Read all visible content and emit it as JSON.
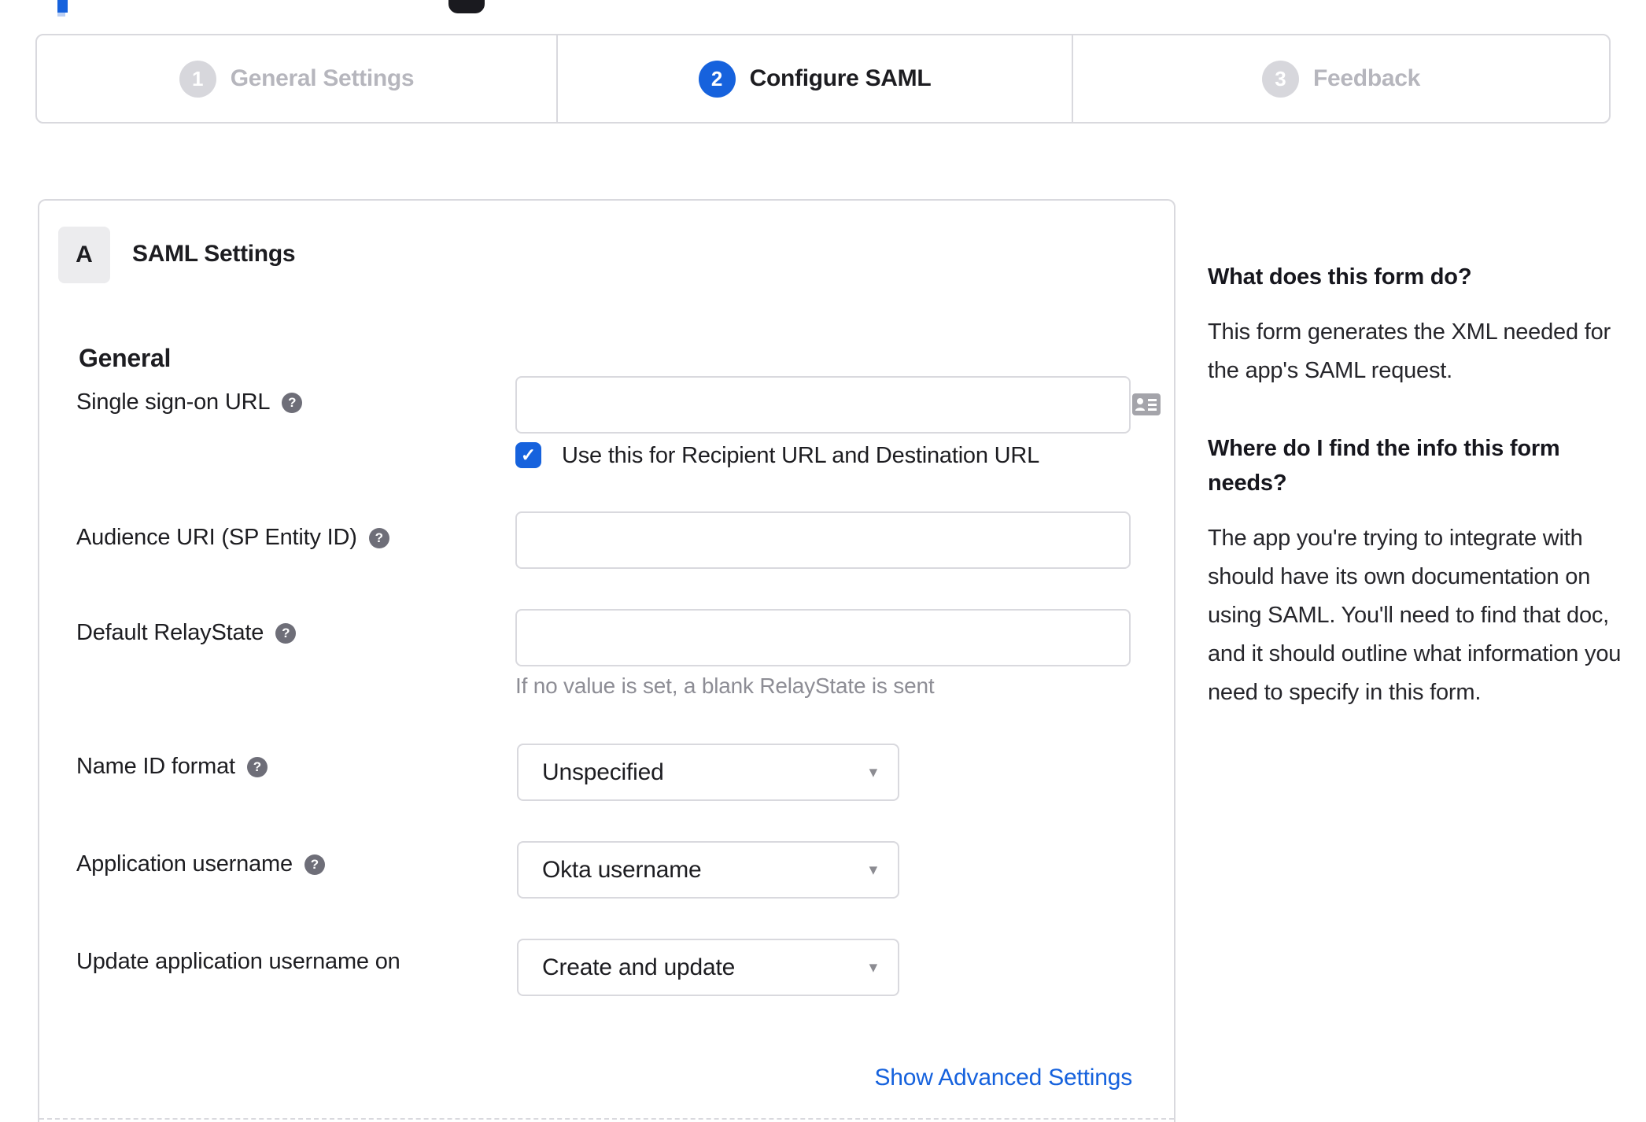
{
  "stepper": {
    "steps": [
      {
        "number": "1",
        "label": "General Settings"
      },
      {
        "number": "2",
        "label": "Configure SAML"
      },
      {
        "number": "3",
        "label": "Feedback"
      }
    ]
  },
  "panel": {
    "badge": "A",
    "title": "SAML Settings",
    "section_heading": "General",
    "fields": {
      "sso": {
        "label": "Single sign-on URL",
        "value": "",
        "checkbox_label": "Use this for Recipient URL and Destination URL"
      },
      "audience": {
        "label": "Audience URI (SP Entity ID)",
        "value": ""
      },
      "relay": {
        "label": "Default RelayState",
        "value": "",
        "helper": "If no value is set, a blank RelayState is sent"
      },
      "nameid": {
        "label": "Name ID format",
        "value": "Unspecified"
      },
      "appuser": {
        "label": "Application username",
        "value": "Okta username"
      },
      "updateuser": {
        "label": "Update application username on",
        "value": "Create and update"
      }
    },
    "advanced_link": "Show Advanced Settings"
  },
  "sidebar": {
    "sections": [
      {
        "heading": "What does this form do?",
        "body": "This form generates the XML needed for the app's SAML request."
      },
      {
        "heading": "Where do I find the info this form needs?",
        "body": "The app you're trying to integrate with should have its own documentation on using SAML. You'll need to find that doc, and it should outline what information you need to specify in this form."
      }
    ]
  },
  "icons": {
    "help": "?",
    "caret": "▾",
    "check": "✓"
  },
  "colors": {
    "accent": "#1662dd",
    "border": "#d9d9de",
    "inactive_text": "#b6b6bd",
    "text": "#1d1d21",
    "muted": "#8d8d95"
  }
}
